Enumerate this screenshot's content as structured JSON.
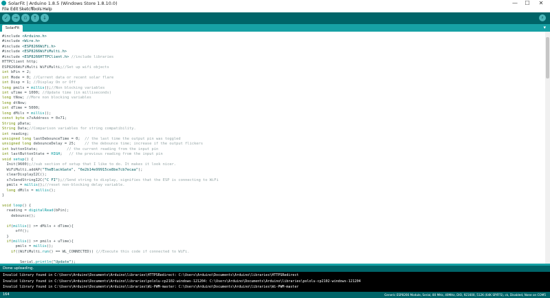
{
  "window": {
    "title": "SolarFit | Arduino 1.8.5 (Windows Store 1.8.10.0)",
    "controls": [
      "—",
      "☐",
      "✕"
    ]
  },
  "menu": [
    "File",
    "Edit",
    "Sketch",
    "Tools",
    "Help"
  ],
  "toolbar": {
    "buttons": [
      {
        "name": "verify-button",
        "glyph": "✓"
      },
      {
        "name": "upload-button",
        "glyph": "→"
      },
      {
        "name": "new-button",
        "glyph": "▫"
      },
      {
        "name": "open-button",
        "glyph": "↑"
      },
      {
        "name": "save-button",
        "glyph": "↓"
      }
    ],
    "serial_glyph": "⌕"
  },
  "tabs": {
    "active": "SolarFit",
    "menu_glyph": "▾"
  },
  "colors": {
    "keyword": "#00979c",
    "type": "#728e00",
    "string": "#005c5f",
    "comment": "#95a5a6",
    "literal": "#00979c",
    "plain": "#434f54"
  },
  "code": [
    [
      {
        "t": "#include ",
        "c": "plain"
      },
      {
        "t": "<Arduino.h>",
        "c": "string"
      }
    ],
    [
      {
        "t": "#include ",
        "c": "plain"
      },
      {
        "t": "<Wire.h>",
        "c": "string"
      }
    ],
    [
      {
        "t": "#include ",
        "c": "plain"
      },
      {
        "t": "<ESP8266WiFi.h>",
        "c": "string"
      }
    ],
    [
      {
        "t": "#include ",
        "c": "plain"
      },
      {
        "t": "<ESP8266WiFiMulti.h>",
        "c": "string"
      }
    ],
    [
      {
        "t": "#include ",
        "c": "plain"
      },
      {
        "t": "<ESP8266HTTPClient.h>",
        "c": "string"
      },
      {
        "t": " //include libraries",
        "c": "comment"
      }
    ],
    [
      {
        "t": "HTTPClient http;",
        "c": "plain"
      }
    ],
    [
      {
        "t": "ESP8266WiFiMulti WiFiMulti;",
        "c": "plain"
      },
      {
        "t": "//Set up wifi objects",
        "c": "comment"
      }
    ],
    [
      {
        "t": "int",
        "c": "type"
      },
      {
        "t": " bPin = 2;",
        "c": "plain"
      }
    ],
    [
      {
        "t": "int",
        "c": "type"
      },
      {
        "t": " Mode = 0; ",
        "c": "plain"
      },
      {
        "t": "//Current data or recent solar flare",
        "c": "comment"
      }
    ],
    [
      {
        "t": "int",
        "c": "type"
      },
      {
        "t": " Disp = 1; ",
        "c": "plain"
      },
      {
        "t": "//Display On or Off",
        "c": "comment"
      }
    ],
    [
      {
        "t": "long",
        "c": "type"
      },
      {
        "t": " pmils = ",
        "c": "plain"
      },
      {
        "t": "millis",
        "c": "keyword"
      },
      {
        "t": "();",
        "c": "plain"
      },
      {
        "t": "//Non blocking variables",
        "c": "comment"
      }
    ],
    [
      {
        "t": "int",
        "c": "type"
      },
      {
        "t": " uTime = 1000; ",
        "c": "plain"
      },
      {
        "t": "//Update time (in milliseconds)",
        "c": "comment"
      }
    ],
    [
      {
        "t": "long",
        "c": "type"
      },
      {
        "t": " tNow; ",
        "c": "plain"
      },
      {
        "t": "//More non blocking variables",
        "c": "comment"
      }
    ],
    [
      {
        "t": "long",
        "c": "type"
      },
      {
        "t": " dtNow;",
        "c": "plain"
      }
    ],
    [
      {
        "t": "int",
        "c": "type"
      },
      {
        "t": " dTime = 5000;",
        "c": "plain"
      }
    ],
    [
      {
        "t": "long",
        "c": "type"
      },
      {
        "t": " dMils = ",
        "c": "plain"
      },
      {
        "t": "millis",
        "c": "keyword"
      },
      {
        "t": "();",
        "c": "plain"
      }
    ],
    [
      {
        "t": "const",
        "c": "type"
      },
      {
        "t": " ",
        "c": "plain"
      },
      {
        "t": "byte",
        "c": "type"
      },
      {
        "t": " s7sAddress = 0x71;",
        "c": "plain"
      }
    ],
    [
      {
        "t": "String",
        "c": "type"
      },
      {
        "t": " pData;",
        "c": "plain"
      }
    ],
    [
      {
        "t": "String",
        "c": "type"
      },
      {
        "t": " Data;",
        "c": "plain"
      },
      {
        "t": "//Comparison variables for string compatibility.",
        "c": "comment"
      }
    ],
    [
      {
        "t": "int",
        "c": "type"
      },
      {
        "t": " reading;",
        "c": "plain"
      }
    ],
    [
      {
        "t": "unsigned long",
        "c": "type"
      },
      {
        "t": " lastDebounceTime = 0;  ",
        "c": "plain"
      },
      {
        "t": "// the last time the output pin was toggled",
        "c": "comment"
      }
    ],
    [
      {
        "t": "unsigned long",
        "c": "type"
      },
      {
        "t": " debounceDelay = 25;    ",
        "c": "plain"
      },
      {
        "t": "// the debounce time; increase if the output flickers",
        "c": "comment"
      }
    ],
    [
      {
        "t": "int",
        "c": "type"
      },
      {
        "t": " buttonState;             ",
        "c": "plain"
      },
      {
        "t": "// the current reading from the input pin",
        "c": "comment"
      }
    ],
    [
      {
        "t": "int",
        "c": "type"
      },
      {
        "t": " lastButtonState = ",
        "c": "plain"
      },
      {
        "t": "HIGH",
        "c": "literal"
      },
      {
        "t": ";   ",
        "c": "plain"
      },
      {
        "t": "// the previous reading from the input pin",
        "c": "comment"
      }
    ],
    [
      {
        "t": "void",
        "c": "type"
      },
      {
        "t": " ",
        "c": "plain"
      },
      {
        "t": "setup",
        "c": "keyword"
      },
      {
        "t": "() {",
        "c": "plain"
      }
    ],
    [
      {
        "t": "  Init(9600);",
        "c": "plain"
      },
      {
        "t": "//sub section of setup that I like to do. It makes it look nicer.",
        "c": "comment"
      }
    ],
    [
      {
        "t": "  WiFiMulti.addAP(",
        "c": "plain"
      },
      {
        "t": "\"TheBlackGate\"",
        "c": "string"
      },
      {
        "t": ", ",
        "c": "plain"
      },
      {
        "t": "\"6e2b14e99915ce8be7cb7ecaa\"",
        "c": "string"
      },
      {
        "t": ");",
        "c": "plain"
      }
    ],
    [
      {
        "t": "  clearDisplayI2C();",
        "c": "plain"
      }
    ],
    [
      {
        "t": "  s7sSendStringI2C(",
        "c": "plain"
      },
      {
        "t": "\"C FI\"",
        "c": "string"
      },
      {
        "t": ");",
        "c": "plain"
      },
      {
        "t": "//Send string to display, signifies that the ESP is connecting to WiFi",
        "c": "comment"
      }
    ],
    [
      {
        "t": "  pmils = ",
        "c": "plain"
      },
      {
        "t": "millis",
        "c": "keyword"
      },
      {
        "t": "();",
        "c": "plain"
      },
      {
        "t": "//reset non-blocking delay variable.",
        "c": "comment"
      }
    ],
    [
      {
        "t": "  ",
        "c": "plain"
      },
      {
        "t": "long",
        "c": "type"
      },
      {
        "t": " dMils = ",
        "c": "plain"
      },
      {
        "t": "millis",
        "c": "keyword"
      },
      {
        "t": "();",
        "c": "plain"
      }
    ],
    [
      {
        "t": "}",
        "c": "plain"
      }
    ],
    [
      {
        "t": "",
        "c": "plain"
      }
    ],
    [
      {
        "t": "void",
        "c": "type"
      },
      {
        "t": " ",
        "c": "plain"
      },
      {
        "t": "loop",
        "c": "keyword"
      },
      {
        "t": "() {",
        "c": "plain"
      }
    ],
    [
      {
        "t": "  reading = ",
        "c": "plain"
      },
      {
        "t": "digitalRead",
        "c": "keyword"
      },
      {
        "t": "(bPin);",
        "c": "plain"
      }
    ],
    [
      {
        "t": "    debounce();",
        "c": "plain"
      }
    ],
    [
      {
        "t": "",
        "c": "plain"
      }
    ],
    [
      {
        "t": "  ",
        "c": "plain"
      },
      {
        "t": "if",
        "c": "type"
      },
      {
        "t": "(",
        "c": "plain"
      },
      {
        "t": "millis",
        "c": "keyword"
      },
      {
        "t": "() >= dMils + dTime){",
        "c": "plain"
      }
    ],
    [
      {
        "t": "      off();",
        "c": "plain"
      }
    ],
    [
      {
        "t": "  }",
        "c": "plain"
      }
    ],
    [
      {
        "t": "  ",
        "c": "plain"
      },
      {
        "t": "if",
        "c": "type"
      },
      {
        "t": "(",
        "c": "plain"
      },
      {
        "t": "millis",
        "c": "keyword"
      },
      {
        "t": "() >= pmils + uTime){",
        "c": "plain"
      }
    ],
    [
      {
        "t": "      pmils = ",
        "c": "plain"
      },
      {
        "t": "millis",
        "c": "keyword"
      },
      {
        "t": "();",
        "c": "plain"
      }
    ],
    [
      {
        "t": "    ",
        "c": "plain"
      },
      {
        "t": "if",
        "c": "type"
      },
      {
        "t": "((WiFiMulti.",
        "c": "plain"
      },
      {
        "t": "run",
        "c": "keyword"
      },
      {
        "t": "() == WL_CONNECTED)) ",
        "c": "plain"
      },
      {
        "t": "{//Execute this code if connected to WiFi.",
        "c": "comment"
      }
    ],
    [
      {
        "t": "",
        "c": "plain"
      }
    ],
    [
      {
        "t": "        Serial.",
        "c": "plain"
      },
      {
        "t": "println",
        "c": "keyword"
      },
      {
        "t": "(",
        "c": "plain"
      },
      {
        "t": "\"Update\"",
        "c": "string"
      },
      {
        "t": ");",
        "c": "plain"
      }
    ]
  ],
  "status": {
    "message": "Done uploading."
  },
  "console": [
    "Invalid library found in C:\\Users\\Arduino\\Documents\\Arduino\\libraries\\HTTPSRedirect: C:\\Users\\Arduino\\Documents\\Arduino\\libraries\\HTTPSRedirect",
    "Invalid library found in C:\\Users\\Arduino\\Documents\\Arduino\\libraries\\pololu-cp2102-windows-121204: C:\\Users\\Arduino\\Documents\\Arduino\\libraries\\pololu-cp2102-windows-121204",
    "Invalid library found in C:\\Users\\Arduino\\Documents\\Arduino\\libraries\\Wi-PWM-master: C:\\Users\\Arduino\\Documents\\Arduino\\libraries\\Wi-PWM-master"
  ],
  "footer": {
    "line_number": "164",
    "board_info": "Generic ESP8266 Module, Serial, 80 MHz, 40MHz, DIO, 921600, 512K (64K SPIFFS), ck, Disabled, None on COM5"
  }
}
